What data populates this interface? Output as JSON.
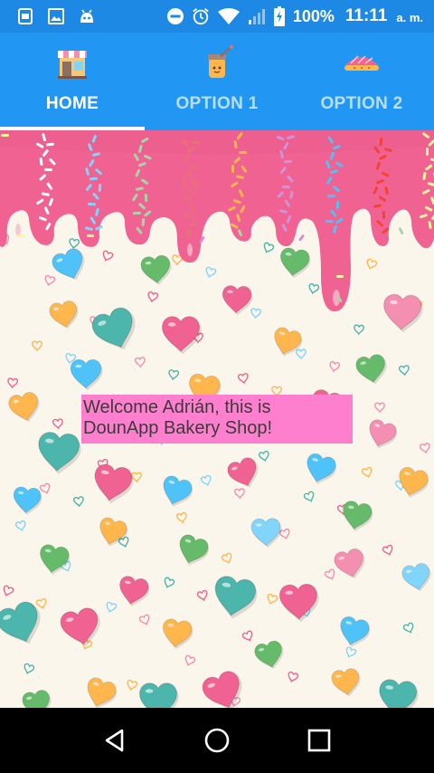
{
  "status_bar": {
    "icons_left": [
      "notification-icon",
      "image-icon",
      "android-icon"
    ],
    "icons_right": [
      "do-not-disturb-icon",
      "alarm-icon",
      "wifi-icon",
      "signal-icon",
      "battery-charging-icon"
    ],
    "battery": "100%",
    "time": "11:11",
    "ampm": "a. m."
  },
  "tabs": [
    {
      "label": "HOME",
      "icon": "shop-icon",
      "active": true
    },
    {
      "label": "OPTION 1",
      "icon": "jar-icon",
      "active": false
    },
    {
      "label": "OPTION 2",
      "icon": "pie-icon",
      "active": false
    }
  ],
  "content": {
    "welcome_text": "Welcome Adrián, this is DounApp Bakery Shop!",
    "background": "candy-hearts-with-pink-frosting"
  },
  "nav_bar": {
    "buttons": [
      "back-icon",
      "home-circle-icon",
      "recents-square-icon"
    ]
  },
  "colors": {
    "status_bar": "#1E88E5",
    "tab_bar": "#2196F3",
    "welcome_bg": "#FF7FCF",
    "frosting": "#F06292",
    "content_bg": "#FBF6EC"
  }
}
